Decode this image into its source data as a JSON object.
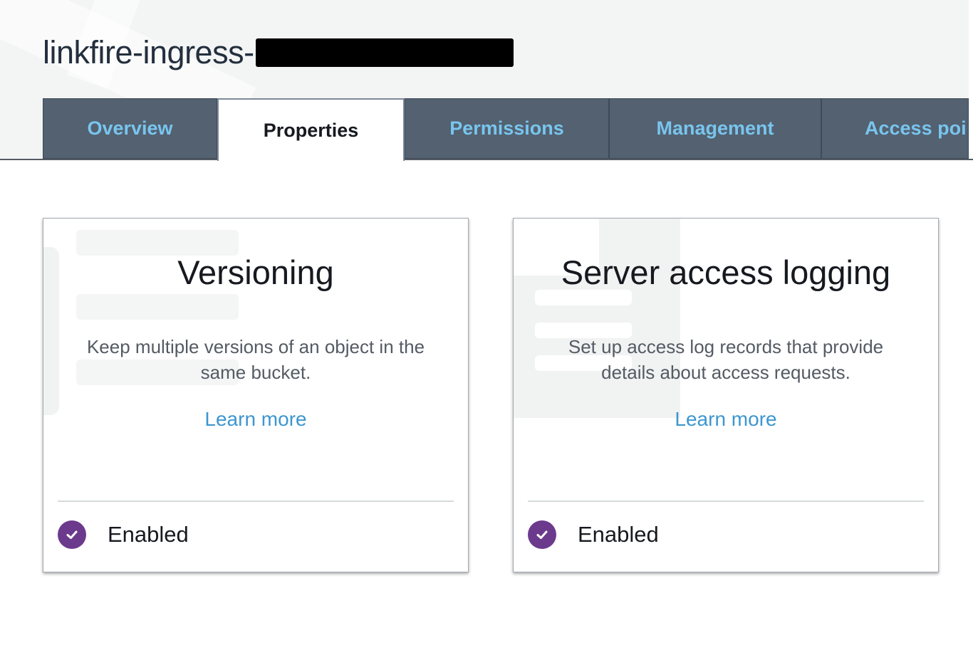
{
  "bucket": {
    "title_prefix": "linkfire-ingress-"
  },
  "tabs": [
    {
      "label": "Overview",
      "active": false
    },
    {
      "label": "Properties",
      "active": true
    },
    {
      "label": "Permissions",
      "active": false
    },
    {
      "label": "Management",
      "active": false
    },
    {
      "label": "Access poi",
      "active": false
    }
  ],
  "cards": [
    {
      "title": "Versioning",
      "description": "Keep multiple versions of an object in the same bucket.",
      "link": "Learn more",
      "status": "Enabled",
      "status_icon": "check-circle-icon"
    },
    {
      "title": "Server access logging",
      "description": "Set up access log records that provide details about access requests.",
      "link": "Learn more",
      "status": "Enabled",
      "status_icon": "check-circle-icon"
    }
  ],
  "colors": {
    "tab_bg": "#536170",
    "tab_text": "#79c5ee",
    "link": "#3d96d0",
    "enabled_check": "#6c3a8c"
  }
}
